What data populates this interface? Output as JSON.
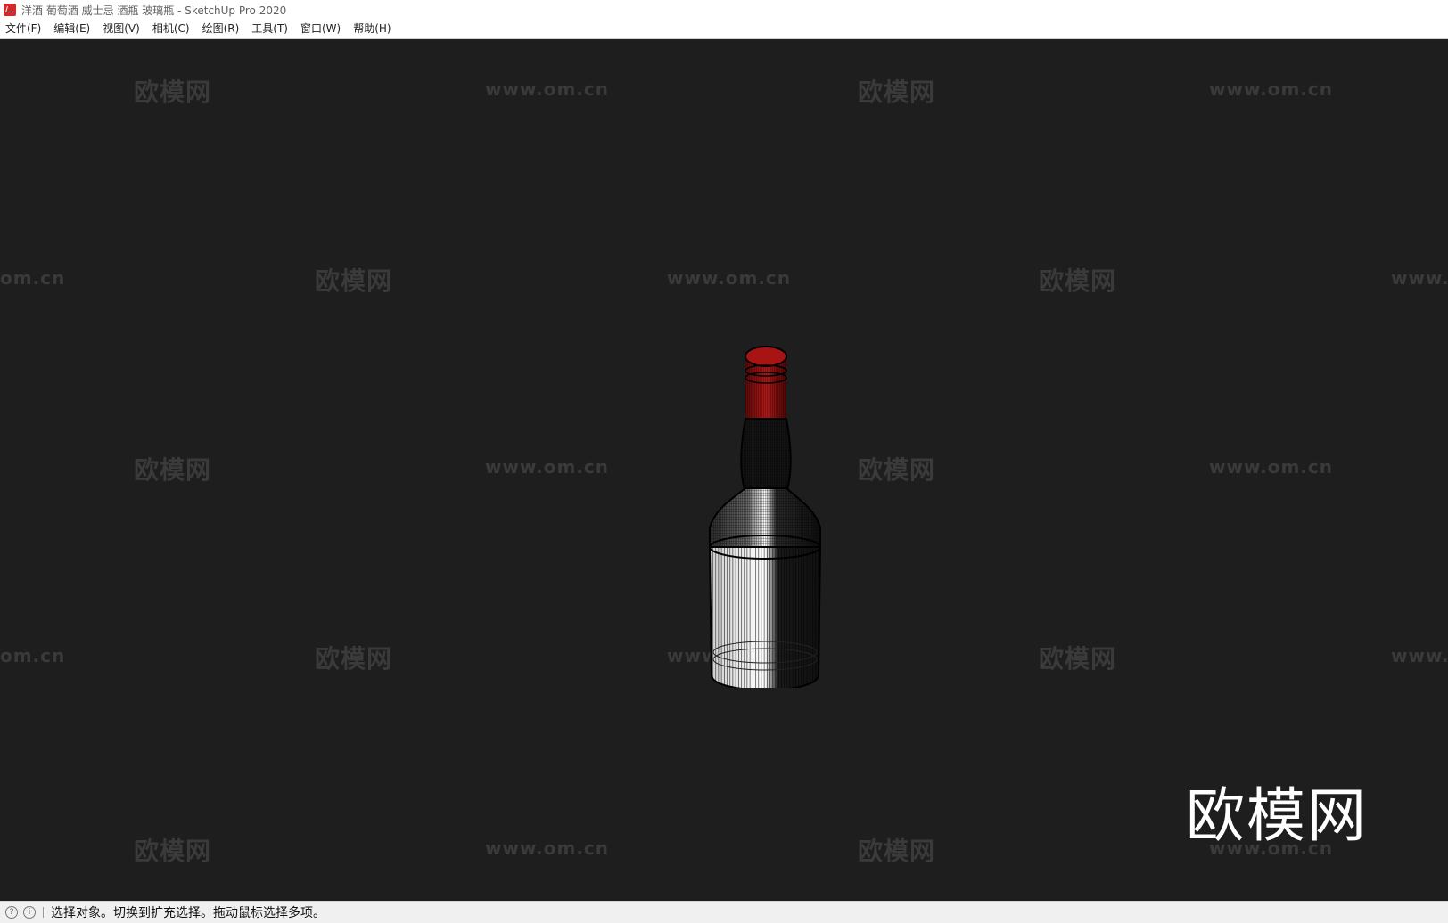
{
  "window": {
    "title": "洋酒 葡萄酒 威士忌 酒瓶 玻璃瓶 - SketchUp Pro 2020"
  },
  "menubar": {
    "items": [
      {
        "label": "文件(F)"
      },
      {
        "label": "编辑(E)"
      },
      {
        "label": "视图(V)"
      },
      {
        "label": "相机(C)"
      },
      {
        "label": "绘图(R)"
      },
      {
        "label": "工具(T)"
      },
      {
        "label": "窗口(W)"
      },
      {
        "label": "帮助(H)"
      }
    ]
  },
  "watermark": {
    "brand": "欧模网",
    "url": "www.om.cn",
    "url_partial_right": "www.",
    "url_partial_left": "om.cn"
  },
  "statusbar": {
    "text": "选择对象。切换到扩充选择。拖动鼠标选择多项。",
    "icons": [
      "geo-location-icon",
      "info-icon"
    ]
  },
  "colors": {
    "viewport_bg": "#1e1e1e",
    "cap": "#8a1010",
    "label": "#ffffff"
  }
}
